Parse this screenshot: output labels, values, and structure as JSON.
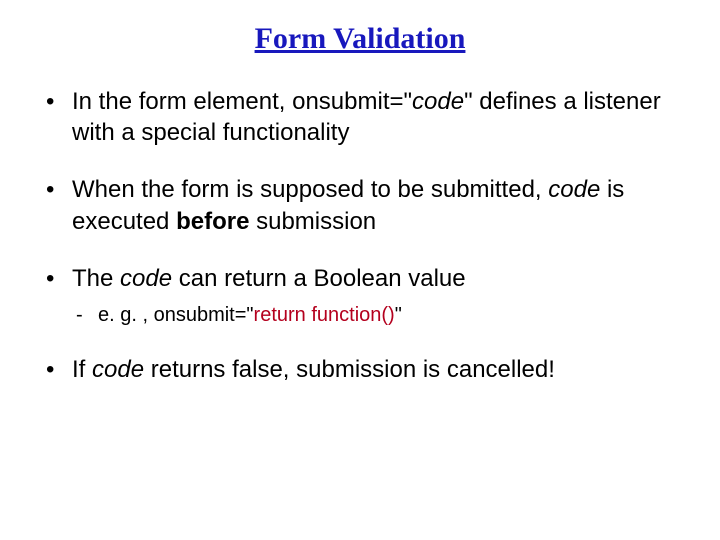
{
  "title": "Form Validation",
  "bullets": {
    "b1a": "In the form element, onsubmit=\"",
    "b1b": "code",
    "b1c": "\" defines a listener with a special functionality",
    "b2a": "When the form is supposed to be submitted, ",
    "b2b": "code",
    "b2c": " is executed ",
    "b2d": "before",
    "b2e": " submission",
    "b3a": "The ",
    "b3b": "code",
    "b3c": " can return a Boolean value",
    "b3sub_a": "e. g. , onsubmit=\"",
    "b3sub_b": "return function()",
    "b3sub_c": "\"",
    "b4a": "If ",
    "b4b": "code",
    "b4c": " returns false, submission is cancelled!"
  }
}
